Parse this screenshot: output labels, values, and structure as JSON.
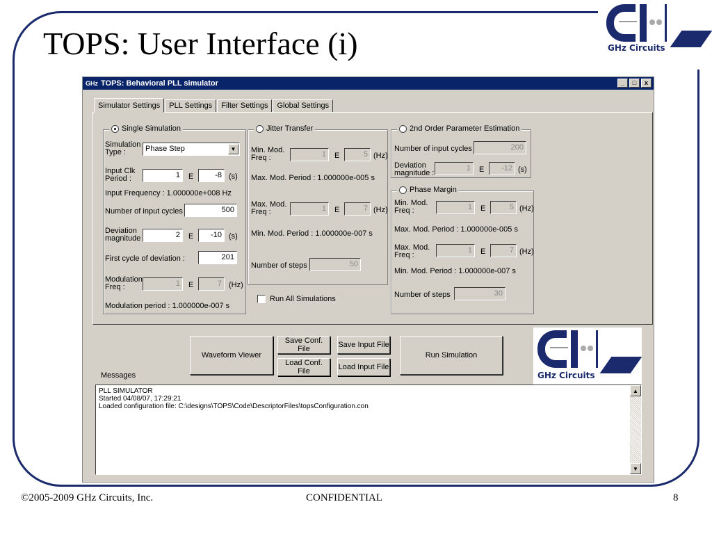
{
  "slide": {
    "title": "TOPS: User Interface (i)",
    "footer_left": "©2005-2009 GHz  Circuits, Inc.",
    "footer_center": "CONFIDENTIAL",
    "page_number": "8",
    "logo_caption": "GHz Circuits"
  },
  "window": {
    "icon": "GHz",
    "title": "TOPS: Behavioral PLL simulator",
    "controls": {
      "minimize": "_",
      "maximize": "□",
      "close": "x"
    }
  },
  "tabs": [
    "Simulator Settings",
    "PLL Settings",
    "Filter Settings",
    "Global Settings"
  ],
  "single_sim": {
    "legend": "Single Simulation",
    "sim_type_label_1": "Simulation",
    "sim_type_label_2": "Type :",
    "sim_type_value": "Phase Step",
    "clk_label_1": "Input Clk",
    "clk_label_2": "Period :",
    "clk_mantissa": "1",
    "clk_exp": "-8",
    "clk_unit": "(s)",
    "e": "E",
    "input_freq": "Input Frequency :  1.000000e+008 Hz",
    "cycles_label": "Number of input cycles :",
    "cycles_value": "500",
    "dev_label_1": "Deviation",
    "dev_label_2": "magnitude :",
    "dev_mantissa": "2",
    "dev_exp": "-10",
    "dev_unit": "(s)",
    "first_cycle_label": "First cycle of deviation :",
    "first_cycle_value": "201",
    "mod_label_1": "Modulation",
    "mod_label_2": "Freq :",
    "mod_mantissa": "1",
    "mod_exp": "7",
    "mod_unit": "(Hz)",
    "mod_period": "Modulation period :  1.000000e-007 s"
  },
  "jitter": {
    "legend": "Jitter Transfer",
    "min_label_1": "Min. Mod.",
    "min_label_2": "Freq :",
    "min_mantissa": "1",
    "min_exp": "5",
    "hz": "(Hz)",
    "max_period": "Max. Mod. Period :  1.000000e-005 s",
    "max_label_1": "Max. Mod.",
    "max_label_2": "Freq :",
    "max_mantissa": "1",
    "max_exp": "7",
    "min_period": "Min. Mod. Period :  1.000000e-007 s",
    "steps_label": "Number of steps",
    "steps_value": "50",
    "run_all": "Run All Simulations"
  },
  "param_est": {
    "legend": "2nd Order Parameter Estimation",
    "cycles_label": "Number of input cycles :",
    "cycles_value": "200",
    "dev_label_1": "Deviation",
    "dev_label_2": "magnitude :",
    "dev_mantissa": "1",
    "dev_exp": "-12",
    "dev_unit": "(s)"
  },
  "phase_margin": {
    "legend": "Phase Margin",
    "min_label_1": "Min. Mod.",
    "min_label_2": "Freq :",
    "min_mantissa": "1",
    "min_exp": "5",
    "hz": "(Hz)",
    "max_period": "Max. Mod. Period :  1.000000e-005 s",
    "max_label_1": "Max. Mod.",
    "max_label_2": "Freq :",
    "max_mantissa": "1",
    "max_exp": "7",
    "min_period": "Min. Mod. Period :  1.000000e-007 s",
    "steps_label": "Number of steps",
    "steps_value": "30"
  },
  "buttons": {
    "waveform": "Waveform Viewer",
    "save_conf": "Save Conf. File",
    "load_conf": "Load Conf. File",
    "save_input": "Save Input File",
    "load_input": "Load Input File",
    "run": "Run Simulation"
  },
  "messages": {
    "label": "Messages",
    "lines": [
      "PLL SIMULATOR",
      "Started 04/08/07, 17:29:21",
      "Loaded configuration file: C:\\designs\\TOPS\\Code\\DescriptorFiles\\topsConfiguration.con"
    ]
  },
  "icons": {
    "scroll_up": "▲",
    "scroll_down": "▼",
    "dropdown": "▼"
  },
  "colors": {
    "brand_navy": "#1a2a6c",
    "titlebar": "#0a246a",
    "window_face": "#d4d0c8"
  }
}
